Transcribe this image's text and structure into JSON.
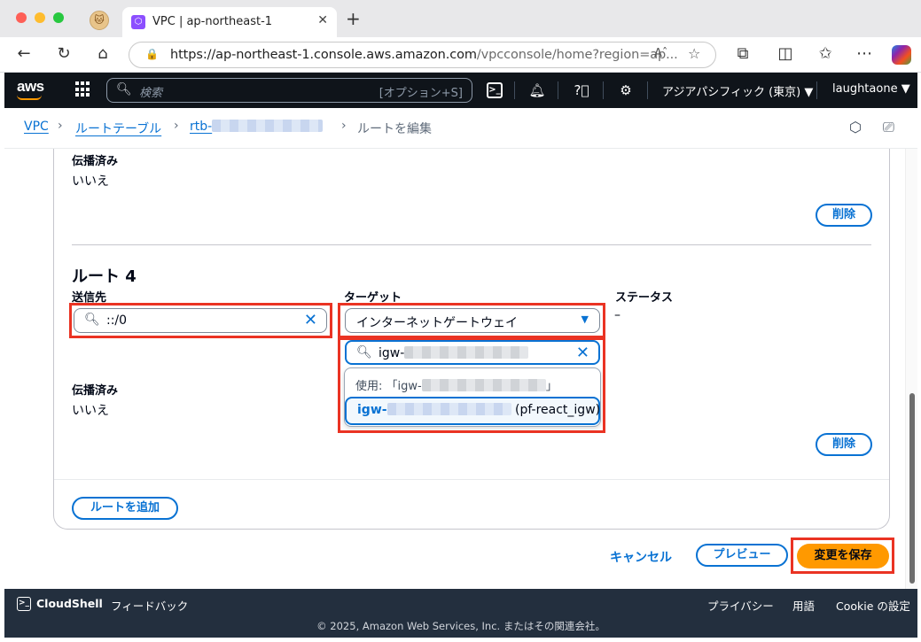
{
  "browser": {
    "tab_title": "VPC | ap-northeast-1",
    "tab_close": "✕",
    "new_tab": "+",
    "url_host": "https://ap-northeast-1.console.aws.amazon.com",
    "url_path": "/vpcconsole/home?region=ap...",
    "read_aloud": "Aˆ"
  },
  "aws_nav": {
    "logo": "aws",
    "search_placeholder": "検索",
    "search_shortcut": "[オプション+S]",
    "region": "アジアパシフィック (東京) ▼",
    "user": "laughtaone ▼"
  },
  "breadcrumb": {
    "items": [
      "VPC",
      "ルートテーブル",
      "rtb-"
    ],
    "current": "ルートを編集"
  },
  "route3": {
    "propagated_label": "伝播済み",
    "propagated_value": "いいえ",
    "delete_label": "削除"
  },
  "route4": {
    "heading": "ルート 4",
    "destination_label": "送信先",
    "destination_value": "::/0",
    "target_label": "ターゲット",
    "target_value": "インターネットゲートウェイ",
    "status_label": "ステータス",
    "status_value": "–",
    "filter_value": "igw-",
    "use_option_prefix": "使用: 「igw-",
    "use_option_suffix": "」",
    "option_id": "igw-",
    "option_name": "(pf-react_igw)",
    "propagated_label": "伝播済み",
    "propagated_value": "いいえ",
    "delete_label": "削除"
  },
  "actions": {
    "add_route": "ルートを追加",
    "cancel": "キャンセル",
    "preview": "プレビュー",
    "save": "変更を保存"
  },
  "footer": {
    "cloudshell": "CloudShell",
    "feedback": "フィードバック",
    "privacy": "プライバシー",
    "terms": "用語",
    "cookie": "Cookie の設定",
    "copyright": "© 2025, Amazon Web Services, Inc. またはその関連会社。"
  },
  "colors": {
    "aws_nav_bg": "#0f141a",
    "link_blue": "#0972d3",
    "primary_orange": "#ff9900",
    "highlight_red": "#ea3323",
    "footer_bg": "#232f3e"
  }
}
